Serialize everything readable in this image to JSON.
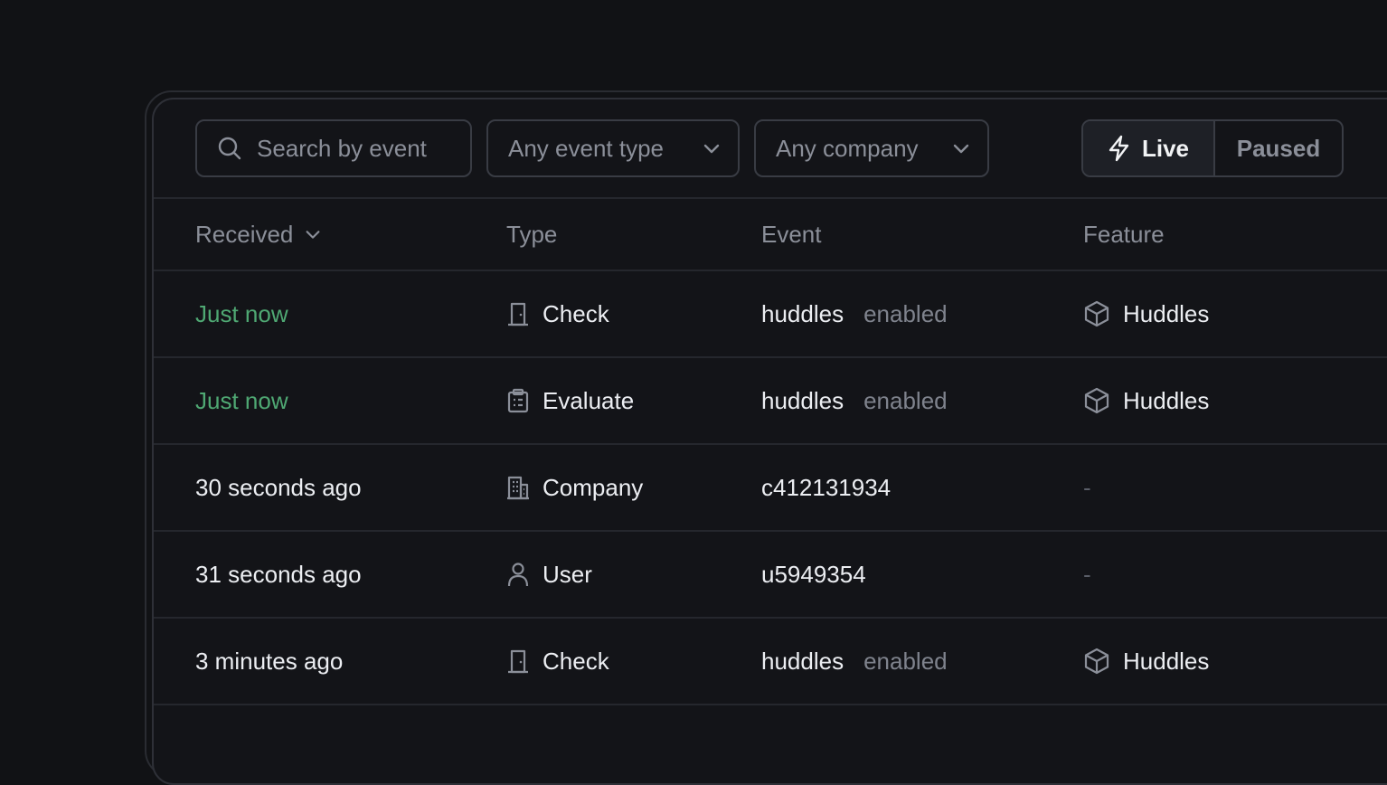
{
  "toolbar": {
    "search_placeholder": "Search by event",
    "event_type_filter": "Any event type",
    "company_filter": "Any company",
    "live_label": "Live",
    "paused_label": "Paused"
  },
  "table": {
    "headers": {
      "received": "Received",
      "type": "Type",
      "event": "Event",
      "feature": "Feature"
    },
    "rows": [
      {
        "received": "Just now",
        "recent": true,
        "type": "Check",
        "type_icon": "door-icon",
        "event_name": "huddles",
        "event_action": "enabled",
        "feature": "Huddles"
      },
      {
        "received": "Just now",
        "recent": true,
        "type": "Evaluate",
        "type_icon": "clipboard-icon",
        "event_name": "huddles",
        "event_action": "enabled",
        "feature": "Huddles"
      },
      {
        "received": "30 seconds ago",
        "recent": false,
        "type": "Company",
        "type_icon": "building-icon",
        "event_name": "c412131934",
        "event_action": "",
        "feature": "-"
      },
      {
        "received": "31 seconds ago",
        "recent": false,
        "type": "User",
        "type_icon": "user-icon",
        "event_name": "u5949354",
        "event_action": "",
        "feature": "-"
      },
      {
        "received": "3 minutes ago",
        "recent": false,
        "type": "Check",
        "type_icon": "door-icon",
        "event_name": "huddles",
        "event_action": "enabled",
        "feature": "Huddles"
      }
    ]
  },
  "colors": {
    "background": "#111215",
    "recent_text": "#4fa873",
    "muted_text": "#8b8f99"
  }
}
